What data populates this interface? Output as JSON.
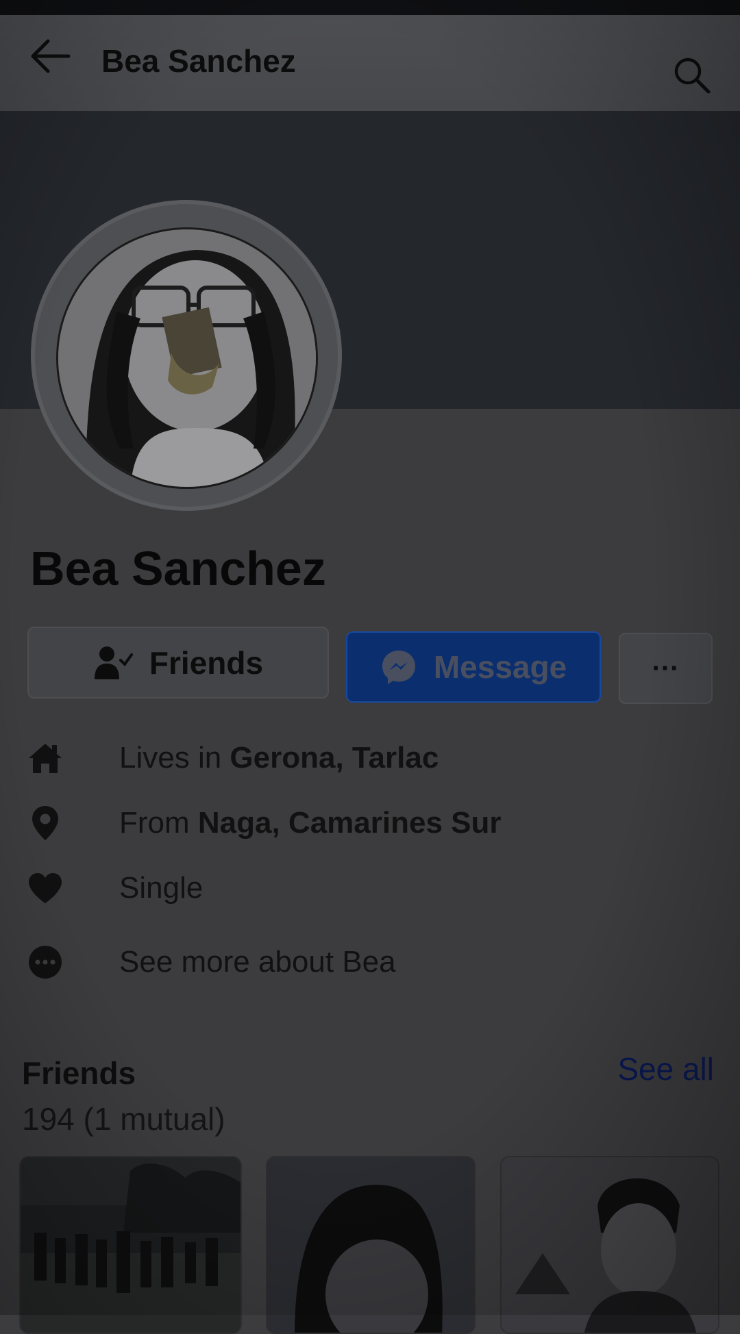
{
  "header": {
    "title": "Bea Sanchez",
    "back_icon": "arrow-left-icon",
    "search_icon": "search-icon"
  },
  "profile": {
    "name": "Bea Sanchez"
  },
  "actions": {
    "friends_label": "Friends",
    "message_label": "Message",
    "more_label": "···"
  },
  "about": {
    "lives_prefix": "Lives in ",
    "lives_value": "Gerona, Tarlac",
    "from_prefix": "From ",
    "from_value": "Naga, Camarines Sur",
    "relationship": "Single",
    "see_more": "See more about Bea"
  },
  "friends_section": {
    "title": "Friends",
    "see_all": "See all",
    "count": "194 (1 mutual)"
  },
  "colors": {
    "message_button": "#0b2f6e",
    "see_all_link": "#0a1852"
  }
}
